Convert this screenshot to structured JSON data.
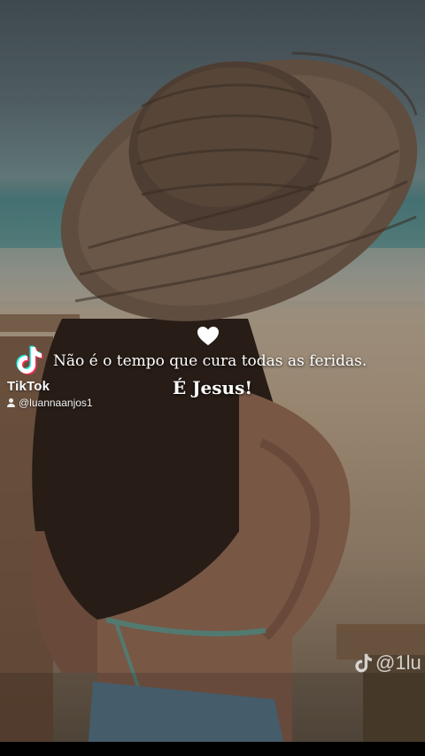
{
  "overlay": {
    "brand": "TikTok",
    "username": "@luannaanjos1",
    "quote_line1": "Não é o tempo que cura todas as feridas.",
    "quote_line2": "É Jesus!",
    "corner_watermark": "@1lu"
  },
  "icons": [
    "tiktok-logo-icon",
    "user-icon",
    "heart-icon",
    "tiktok-note-icon"
  ],
  "colors": {
    "text": "#ffffff",
    "tiktok_cyan": "#25f4ee",
    "tiktok_red": "#fe2c55"
  }
}
